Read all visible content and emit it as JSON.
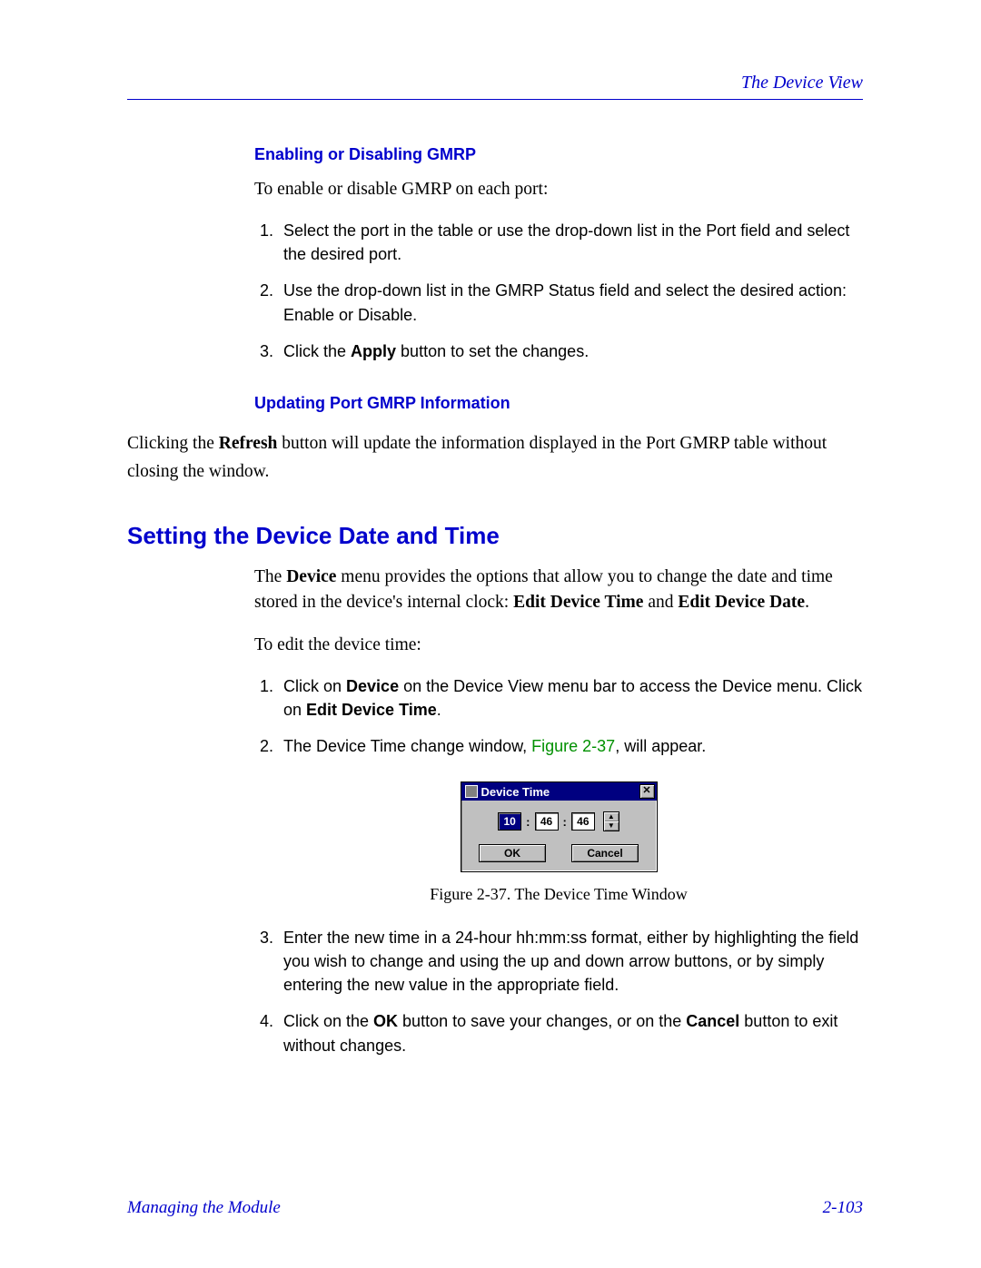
{
  "header": {
    "right_link": "The Device View"
  },
  "sec1": {
    "heading": "Enabling or Disabling GMRP",
    "intro": "To enable or disable GMRP on each port:",
    "steps": [
      "Select the port in the table or use the drop-down list in the Port field and select the desired port.",
      "Use the drop-down list in the GMRP Status field and select the desired action: Enable or Disable.",
      {
        "pre": "Click the ",
        "bold": "Apply",
        "post": " button to set the changes."
      }
    ]
  },
  "sec2": {
    "heading": "Updating Port GMRP Information",
    "para_pre": "Clicking the ",
    "para_bold": "Refresh",
    "para_post": " button will update the information displayed in the Port GMRP table without closing the window."
  },
  "sec3": {
    "title": "Setting the Device Date and Time",
    "intro_parts": {
      "t1": "The ",
      "b1": "Device",
      "t2": " menu provides the options that allow you to change the date and time stored in the device's internal clock: ",
      "b2": "Edit Device Time",
      "t3": " and ",
      "b3": "Edit Device Date",
      "t4": "."
    },
    "lead": "To edit the device time:",
    "step1": {
      "t1": "Click on ",
      "b1": "Device",
      "t2": " on the Device View menu bar to access the Device menu. Click on ",
      "b2": "Edit Device Time",
      "t3": "."
    },
    "step2": {
      "t1": "The Device Time change window, ",
      "fig": "Figure 2-37",
      "t2": ", will appear."
    },
    "step3": "Enter the new time in a 24-hour hh:mm:ss format, either by highlighting the field you wish to change and using the up and down arrow buttons, or by simply entering the new value in the appropriate field.",
    "step4": {
      "t1": "Click on the ",
      "b1": "OK",
      "t2": " button to save your changes, or on the ",
      "b2": "Cancel",
      "t3": " button to exit without changes."
    },
    "caption": "Figure 2-37.  The Device Time Window"
  },
  "window": {
    "title": "Device Time",
    "close_glyph": "✕",
    "hh": "10",
    "mm": "46",
    "ss": "46",
    "colon": ":",
    "up": "▲",
    "down": "▼",
    "ok": "OK",
    "cancel": "Cancel"
  },
  "footer": {
    "left": "Managing the Module",
    "right": "2-103"
  }
}
